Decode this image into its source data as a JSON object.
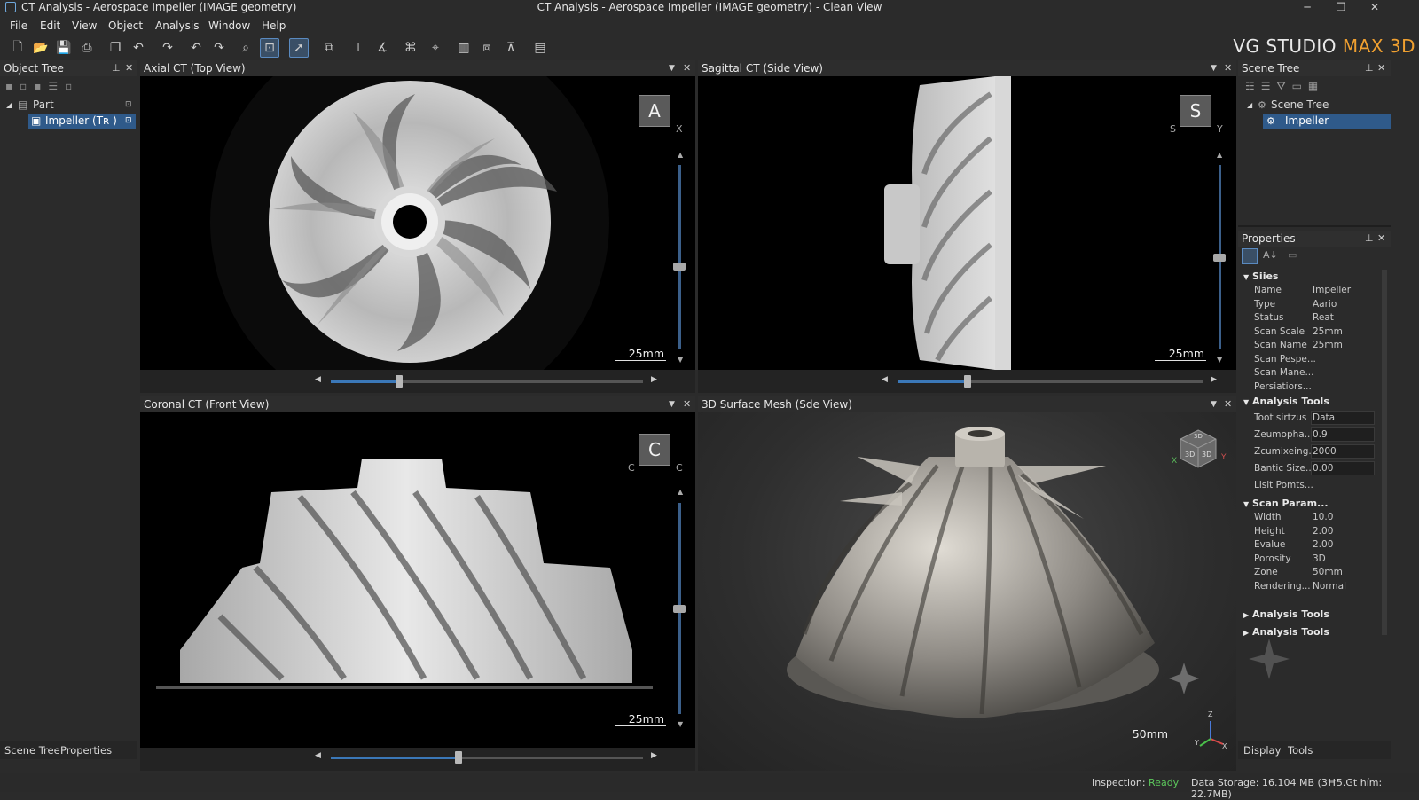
{
  "window": {
    "title_left": "CT Analysis - Aerospace Impeller (IMAGE geometry)",
    "title_center": "CT Analysis - Aerospace Impeller (IMAGE geometry) - Clean View"
  },
  "menu": [
    "File",
    "Edit",
    "View",
    "Object",
    "Analysis",
    "Window",
    "Help"
  ],
  "brand": {
    "a": "VG STUDIO ",
    "b": "MAX 3D"
  },
  "object_tree": {
    "title": "Object Tree",
    "part": "Part",
    "item": "Impeller (Tʀ )",
    "tabs": [
      "Scene Tree",
      "Properties"
    ]
  },
  "viewports": [
    {
      "title": "Axial CT (Top View)",
      "badge": "A",
      "axis": "X",
      "scale": "25mm"
    },
    {
      "title": "Sagittal CT (Side View)",
      "badge": "S",
      "axis_l": "S",
      "axis_r": "Y",
      "scale": "25mm"
    },
    {
      "title": "Coronal CT (Front View)",
      "badge": "C",
      "axis_l": "C",
      "axis_r": "C",
      "scale": "25mm"
    },
    {
      "title": "3D Surface Mesh (Sde View)",
      "scale": "50mm",
      "cube": "3D",
      "cube_l": "3D",
      "cube_r": "3D",
      "ax_x": "X",
      "ax_y": "Y",
      "ax_z": "Z"
    }
  ],
  "scene_tree": {
    "title": "Scene Tree",
    "root": "Scene Tree",
    "item": "Impeller"
  },
  "properties": {
    "title": "Properties",
    "sec1": "Siies",
    "rows1": [
      [
        "Name",
        "Impeller"
      ],
      [
        "Type",
        "Aario"
      ],
      [
        "Status",
        "Reat"
      ],
      [
        "Scan Scale",
        "25mm"
      ],
      [
        "Scan Name",
        "25mm"
      ],
      [
        "Scan Pespe...",
        ""
      ],
      [
        "Scan Mane...",
        ""
      ],
      [
        "Persiatiors...",
        ""
      ]
    ],
    "sec2": "Analysis Tools",
    "rows2": [
      [
        "Toot sirtzus",
        "Data"
      ],
      [
        "Zeumopha...",
        "0.9"
      ],
      [
        "Zcumixeing...",
        "2000"
      ],
      [
        "Bantic Size...",
        "0.00"
      ],
      [
        "Lisit Pomts...",
        ""
      ]
    ],
    "sec3": "Scan Param...",
    "rows3": [
      [
        "Width",
        "10.0"
      ],
      [
        "Height",
        "2.00"
      ],
      [
        "Evalue",
        "2.00"
      ],
      [
        "Porosity",
        "3D"
      ],
      [
        "Zone",
        "50mm"
      ],
      [
        "Rendering...",
        "Normal"
      ]
    ],
    "sec4": "Analysis Tools",
    "sec5": "Analysis Tools",
    "tabs": [
      "Display",
      "Tools"
    ]
  },
  "status": {
    "inspection_label": "Inspection: ",
    "inspection_value": "Ready",
    "storage": "Data Storage: 16.104 MB (3Ħ5.Gt hím: 22.7MB)"
  },
  "sliders": {
    "axial_h": 0.22,
    "sagittal_h": 0.23,
    "coronal_h": 0.41,
    "axial_v": 0.55,
    "sagittal_v": 0.5,
    "coronal_v": 0.5
  }
}
